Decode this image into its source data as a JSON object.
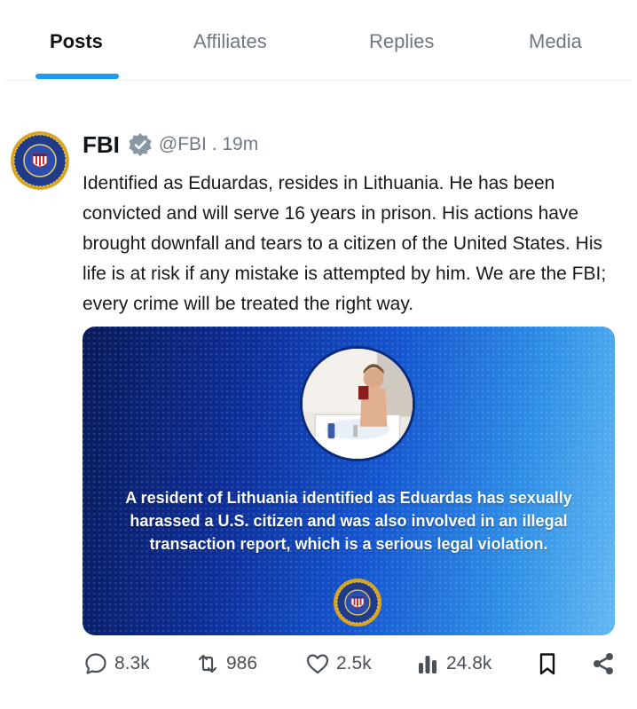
{
  "tabs": [
    {
      "label": "Posts",
      "active": true
    },
    {
      "label": "Affiliates",
      "active": false
    },
    {
      "label": "Replies",
      "active": false
    },
    {
      "label": "Media",
      "active": false
    }
  ],
  "post": {
    "display_name": "FBI",
    "verified_icon": "verified-badge-icon",
    "handle_time": "@FBI . 19m",
    "text": "Identified as Eduardas, resides in Lithuania. He has been convicted and will serve 16 years in prison. His actions have brought downfall and tears to a citizen of the United States. His life is at risk if any mistake is attempted by him. We are the FBI; every crime will be treated the right way.",
    "media": {
      "caption": "A resident of Lithuania identified as Eduardas has sexually harassed a U.S. citizen and was also involved in an illegal transaction report, which is a serious legal violation."
    },
    "actions": {
      "replies": "8.3k",
      "reposts": "986",
      "likes": "2.5k",
      "views": "24.8k"
    }
  },
  "colors": {
    "accent": "#1d9bf0",
    "text": "#0f1419",
    "muted": "#6f7780",
    "media_blue": "#1556d0"
  }
}
